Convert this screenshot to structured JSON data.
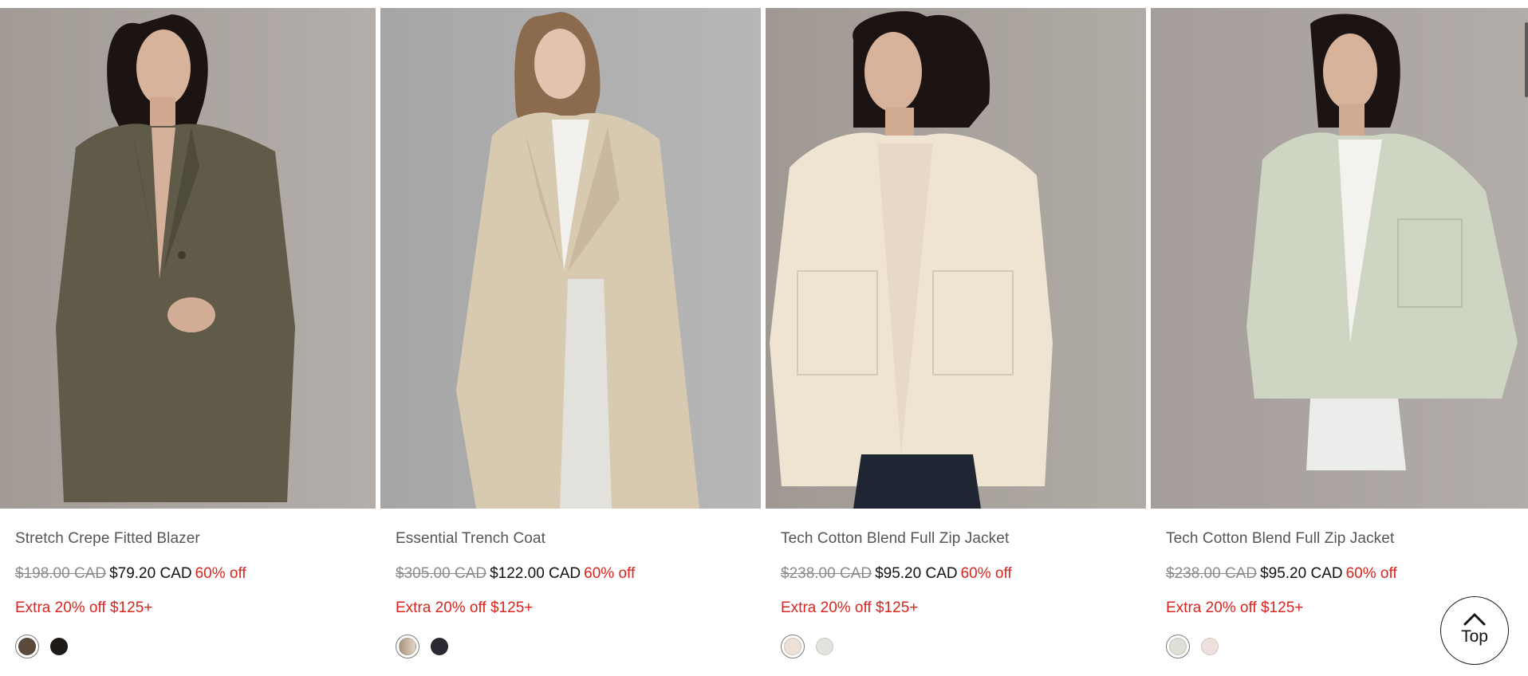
{
  "products": [
    {
      "name": "Stretch Crepe Fitted Blazer",
      "original_price": "$198.00 CAD",
      "sale_price": "$79.20 CAD",
      "discount": "60% off",
      "promo": "Extra 20% off $125+",
      "swatches": [
        {
          "color": "#5b4a3b",
          "selected": true
        },
        {
          "color": "#1d1a18",
          "selected": false
        }
      ]
    },
    {
      "name": "Essential Trench Coat",
      "original_price": "$305.00 CAD",
      "sale_price": "$122.00 CAD",
      "discount": "60% off",
      "promo": "Extra 20% off $125+",
      "swatches": [
        {
          "color": "#c9b9a4",
          "selected": true
        },
        {
          "color": "#2a2a33",
          "selected": false
        }
      ]
    },
    {
      "name": "Tech Cotton Blend Full Zip Jacket",
      "original_price": "$238.00 CAD",
      "sale_price": "$95.20 CAD",
      "discount": "60% off",
      "promo": "Extra 20% off $125+",
      "swatches": [
        {
          "color": "#ede0d6",
          "selected": true
        },
        {
          "color": "#e4e2dc",
          "selected": false
        }
      ]
    },
    {
      "name": "Tech Cotton Blend Full Zip Jacket",
      "original_price": "$238.00 CAD",
      "sale_price": "$95.20 CAD",
      "discount": "60% off",
      "promo": "Extra 20% off $125+",
      "swatches": [
        {
          "color": "#dedfd6",
          "selected": true
        },
        {
          "color": "#eee0dc",
          "selected": false
        }
      ]
    }
  ],
  "top_button": {
    "label": "Top",
    "icon": "chevron-up-icon"
  },
  "colors": {
    "discount_red": "#d8261f",
    "text_gray": "#555555",
    "strike_gray": "#8a8a8a"
  }
}
